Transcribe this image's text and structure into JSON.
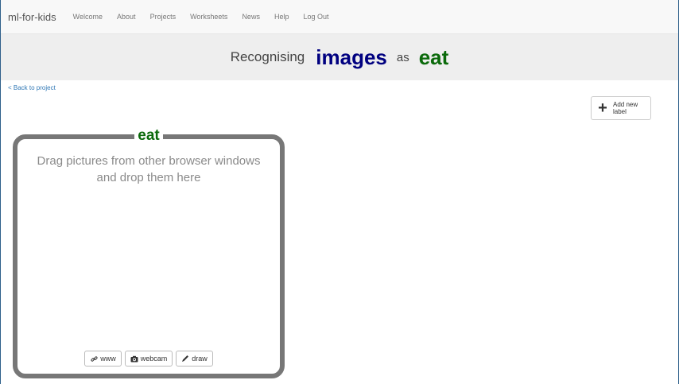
{
  "navbar": {
    "brand": "ml-for-kids",
    "links": [
      "Welcome",
      "About",
      "Projects",
      "Worksheets",
      "News",
      "Help",
      "Log Out"
    ]
  },
  "title": {
    "recognising": "Recognising",
    "type": "images",
    "as": "as",
    "label": "eat"
  },
  "back_link": "< Back to project",
  "add_label_button": {
    "icon": "plus-icon",
    "label": "Add new label"
  },
  "label_box": {
    "name": "eat",
    "hint": "Drag pictures from other browser windows and drop them here",
    "buttons": [
      {
        "icon": "link-icon",
        "label": "www"
      },
      {
        "icon": "camera-icon",
        "label": "webcam"
      },
      {
        "icon": "pencil-icon",
        "label": "draw"
      }
    ]
  },
  "colors": {
    "type_color": "#000080",
    "label_color": "#0b6a0b",
    "box_border": "#777777",
    "link_color": "#337ab7"
  }
}
